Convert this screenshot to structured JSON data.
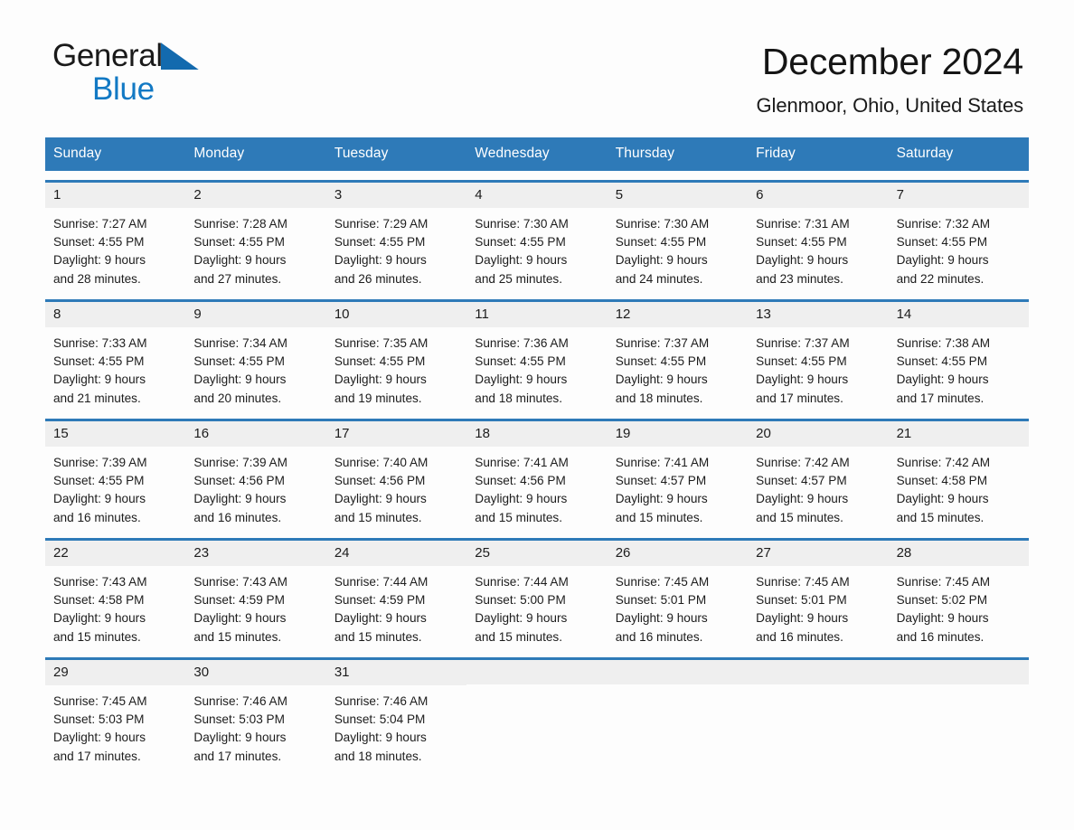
{
  "brand": {
    "name_part1": "General",
    "name_part2": "Blue",
    "triangle_icon": "blue-triangle-icon",
    "accent_color": "#1279c4"
  },
  "header": {
    "title": "December 2024",
    "location": "Glenmoor, Ohio, United States"
  },
  "calendar": {
    "header_bg_color": "#2e7ab8",
    "day_band_color": "#efefef",
    "weekdays": [
      "Sunday",
      "Monday",
      "Tuesday",
      "Wednesday",
      "Thursday",
      "Friday",
      "Saturday"
    ],
    "weeks": [
      [
        {
          "day": "1",
          "sunrise": "Sunrise: 7:27 AM",
          "sunset": "Sunset: 4:55 PM",
          "daylight_line1": "Daylight: 9 hours",
          "daylight_line2": "and 28 minutes."
        },
        {
          "day": "2",
          "sunrise": "Sunrise: 7:28 AM",
          "sunset": "Sunset: 4:55 PM",
          "daylight_line1": "Daylight: 9 hours",
          "daylight_line2": "and 27 minutes."
        },
        {
          "day": "3",
          "sunrise": "Sunrise: 7:29 AM",
          "sunset": "Sunset: 4:55 PM",
          "daylight_line1": "Daylight: 9 hours",
          "daylight_line2": "and 26 minutes."
        },
        {
          "day": "4",
          "sunrise": "Sunrise: 7:30 AM",
          "sunset": "Sunset: 4:55 PM",
          "daylight_line1": "Daylight: 9 hours",
          "daylight_line2": "and 25 minutes."
        },
        {
          "day": "5",
          "sunrise": "Sunrise: 7:30 AM",
          "sunset": "Sunset: 4:55 PM",
          "daylight_line1": "Daylight: 9 hours",
          "daylight_line2": "and 24 minutes."
        },
        {
          "day": "6",
          "sunrise": "Sunrise: 7:31 AM",
          "sunset": "Sunset: 4:55 PM",
          "daylight_line1": "Daylight: 9 hours",
          "daylight_line2": "and 23 minutes."
        },
        {
          "day": "7",
          "sunrise": "Sunrise: 7:32 AM",
          "sunset": "Sunset: 4:55 PM",
          "daylight_line1": "Daylight: 9 hours",
          "daylight_line2": "and 22 minutes."
        }
      ],
      [
        {
          "day": "8",
          "sunrise": "Sunrise: 7:33 AM",
          "sunset": "Sunset: 4:55 PM",
          "daylight_line1": "Daylight: 9 hours",
          "daylight_line2": "and 21 minutes."
        },
        {
          "day": "9",
          "sunrise": "Sunrise: 7:34 AM",
          "sunset": "Sunset: 4:55 PM",
          "daylight_line1": "Daylight: 9 hours",
          "daylight_line2": "and 20 minutes."
        },
        {
          "day": "10",
          "sunrise": "Sunrise: 7:35 AM",
          "sunset": "Sunset: 4:55 PM",
          "daylight_line1": "Daylight: 9 hours",
          "daylight_line2": "and 19 minutes."
        },
        {
          "day": "11",
          "sunrise": "Sunrise: 7:36 AM",
          "sunset": "Sunset: 4:55 PM",
          "daylight_line1": "Daylight: 9 hours",
          "daylight_line2": "and 18 minutes."
        },
        {
          "day": "12",
          "sunrise": "Sunrise: 7:37 AM",
          "sunset": "Sunset: 4:55 PM",
          "daylight_line1": "Daylight: 9 hours",
          "daylight_line2": "and 18 minutes."
        },
        {
          "day": "13",
          "sunrise": "Sunrise: 7:37 AM",
          "sunset": "Sunset: 4:55 PM",
          "daylight_line1": "Daylight: 9 hours",
          "daylight_line2": "and 17 minutes."
        },
        {
          "day": "14",
          "sunrise": "Sunrise: 7:38 AM",
          "sunset": "Sunset: 4:55 PM",
          "daylight_line1": "Daylight: 9 hours",
          "daylight_line2": "and 17 minutes."
        }
      ],
      [
        {
          "day": "15",
          "sunrise": "Sunrise: 7:39 AM",
          "sunset": "Sunset: 4:55 PM",
          "daylight_line1": "Daylight: 9 hours",
          "daylight_line2": "and 16 minutes."
        },
        {
          "day": "16",
          "sunrise": "Sunrise: 7:39 AM",
          "sunset": "Sunset: 4:56 PM",
          "daylight_line1": "Daylight: 9 hours",
          "daylight_line2": "and 16 minutes."
        },
        {
          "day": "17",
          "sunrise": "Sunrise: 7:40 AM",
          "sunset": "Sunset: 4:56 PM",
          "daylight_line1": "Daylight: 9 hours",
          "daylight_line2": "and 15 minutes."
        },
        {
          "day": "18",
          "sunrise": "Sunrise: 7:41 AM",
          "sunset": "Sunset: 4:56 PM",
          "daylight_line1": "Daylight: 9 hours",
          "daylight_line2": "and 15 minutes."
        },
        {
          "day": "19",
          "sunrise": "Sunrise: 7:41 AM",
          "sunset": "Sunset: 4:57 PM",
          "daylight_line1": "Daylight: 9 hours",
          "daylight_line2": "and 15 minutes."
        },
        {
          "day": "20",
          "sunrise": "Sunrise: 7:42 AM",
          "sunset": "Sunset: 4:57 PM",
          "daylight_line1": "Daylight: 9 hours",
          "daylight_line2": "and 15 minutes."
        },
        {
          "day": "21",
          "sunrise": "Sunrise: 7:42 AM",
          "sunset": "Sunset: 4:58 PM",
          "daylight_line1": "Daylight: 9 hours",
          "daylight_line2": "and 15 minutes."
        }
      ],
      [
        {
          "day": "22",
          "sunrise": "Sunrise: 7:43 AM",
          "sunset": "Sunset: 4:58 PM",
          "daylight_line1": "Daylight: 9 hours",
          "daylight_line2": "and 15 minutes."
        },
        {
          "day": "23",
          "sunrise": "Sunrise: 7:43 AM",
          "sunset": "Sunset: 4:59 PM",
          "daylight_line1": "Daylight: 9 hours",
          "daylight_line2": "and 15 minutes."
        },
        {
          "day": "24",
          "sunrise": "Sunrise: 7:44 AM",
          "sunset": "Sunset: 4:59 PM",
          "daylight_line1": "Daylight: 9 hours",
          "daylight_line2": "and 15 minutes."
        },
        {
          "day": "25",
          "sunrise": "Sunrise: 7:44 AM",
          "sunset": "Sunset: 5:00 PM",
          "daylight_line1": "Daylight: 9 hours",
          "daylight_line2": "and 15 minutes."
        },
        {
          "day": "26",
          "sunrise": "Sunrise: 7:45 AM",
          "sunset": "Sunset: 5:01 PM",
          "daylight_line1": "Daylight: 9 hours",
          "daylight_line2": "and 16 minutes."
        },
        {
          "day": "27",
          "sunrise": "Sunrise: 7:45 AM",
          "sunset": "Sunset: 5:01 PM",
          "daylight_line1": "Daylight: 9 hours",
          "daylight_line2": "and 16 minutes."
        },
        {
          "day": "28",
          "sunrise": "Sunrise: 7:45 AM",
          "sunset": "Sunset: 5:02 PM",
          "daylight_line1": "Daylight: 9 hours",
          "daylight_line2": "and 16 minutes."
        }
      ],
      [
        {
          "day": "29",
          "sunrise": "Sunrise: 7:45 AM",
          "sunset": "Sunset: 5:03 PM",
          "daylight_line1": "Daylight: 9 hours",
          "daylight_line2": "and 17 minutes."
        },
        {
          "day": "30",
          "sunrise": "Sunrise: 7:46 AM",
          "sunset": "Sunset: 5:03 PM",
          "daylight_line1": "Daylight: 9 hours",
          "daylight_line2": "and 17 minutes."
        },
        {
          "day": "31",
          "sunrise": "Sunrise: 7:46 AM",
          "sunset": "Sunset: 5:04 PM",
          "daylight_line1": "Daylight: 9 hours",
          "daylight_line2": "and 18 minutes."
        },
        {
          "day": "",
          "sunrise": "",
          "sunset": "",
          "daylight_line1": "",
          "daylight_line2": ""
        },
        {
          "day": "",
          "sunrise": "",
          "sunset": "",
          "daylight_line1": "",
          "daylight_line2": ""
        },
        {
          "day": "",
          "sunrise": "",
          "sunset": "",
          "daylight_line1": "",
          "daylight_line2": ""
        },
        {
          "day": "",
          "sunrise": "",
          "sunset": "",
          "daylight_line1": "",
          "daylight_line2": ""
        }
      ]
    ]
  }
}
